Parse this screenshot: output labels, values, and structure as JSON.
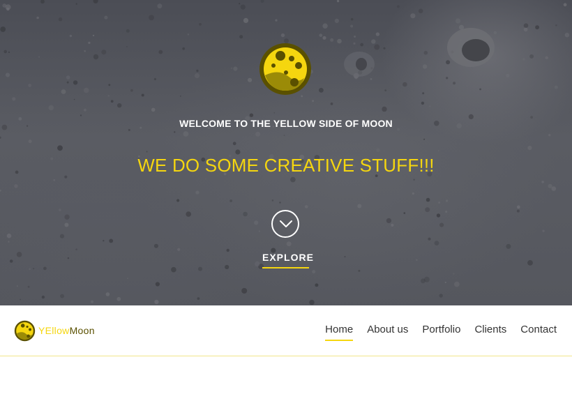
{
  "hero": {
    "welcome_text": "WELCOME TO THE YELLOW SIDE OF MOON",
    "tagline": "WE DO SOME CREATIVE STUFF!!!",
    "explore_label": "EXPLORE",
    "logo_icon": "moon-logo-icon",
    "explore_icon": "chevron-down-icon"
  },
  "navbar": {
    "brand": {
      "part1": "YEllow",
      "part2": "Moon",
      "icon": "moon-logo-icon"
    },
    "items": [
      {
        "label": "Home",
        "active": true
      },
      {
        "label": "About us",
        "active": false
      },
      {
        "label": "Portfolio",
        "active": false
      },
      {
        "label": "Clients",
        "active": false
      },
      {
        "label": "Contact",
        "active": false
      }
    ]
  },
  "colors": {
    "accent": "#f5d60f",
    "moon_dark": "#5a5000",
    "hero_bg": "#55575e",
    "nav_text": "#333333"
  }
}
